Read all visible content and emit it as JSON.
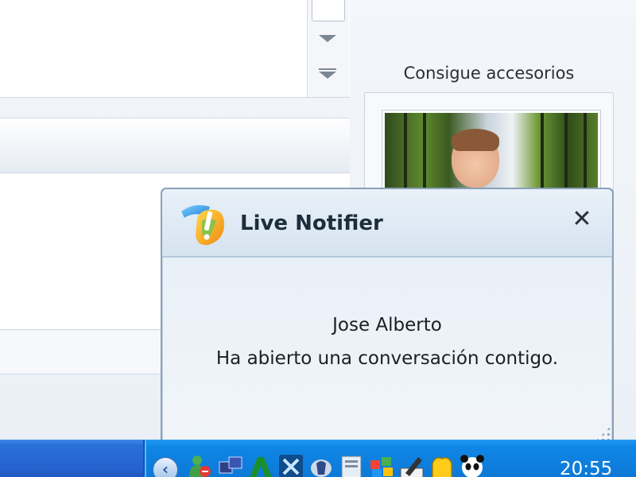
{
  "sidebar": {
    "accessories_title": "Consigue accesorios"
  },
  "notifier": {
    "title": "Live Notifier",
    "close_glyph": "✕",
    "contact_name": "Jose Alberto",
    "message": "Ha abierto una conversación contigo."
  },
  "taskbar": {
    "tray_expand_glyph": "‹",
    "clock": "20:55",
    "tray_icons": [
      "msn-messenger-icon",
      "network-windows-icon",
      "green-app-icon",
      "blue-x-app-icon",
      "security-icon",
      "document-app-icon",
      "colorful-app-icon",
      "pencil-tool-icon",
      "yellow-hand-icon",
      "panda-antivirus-icon"
    ]
  },
  "colors": {
    "taskbar_blue": "#2563cf",
    "tray_blue": "#0d79d6",
    "popup_border": "#8aa0b8"
  }
}
